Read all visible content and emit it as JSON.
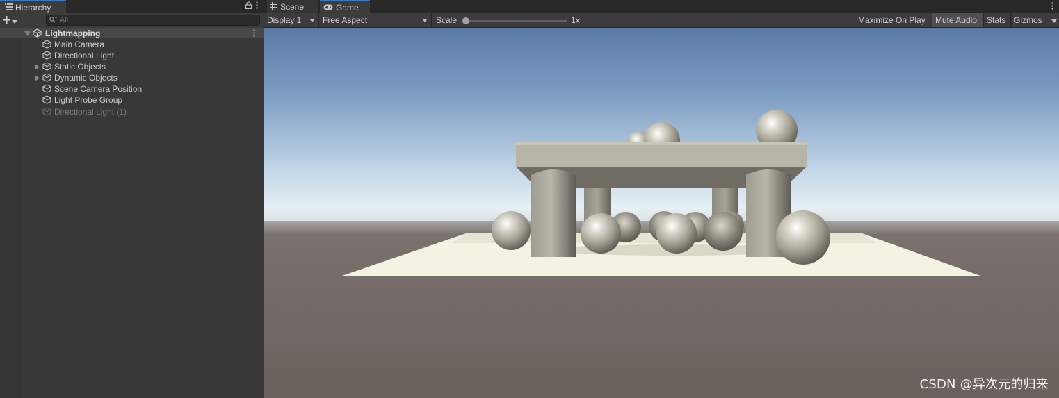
{
  "hierarchy": {
    "tab_label": "Hierarchy",
    "search_placeholder": "All",
    "scene_name": "Lightmapping",
    "items": [
      {
        "label": "Main Camera",
        "expandable": false,
        "active": true
      },
      {
        "label": "Directional Light",
        "expandable": false,
        "active": true
      },
      {
        "label": "Static Objects",
        "expandable": true,
        "active": true
      },
      {
        "label": "Dynamic Objects",
        "expandable": true,
        "active": true
      },
      {
        "label": "Scene Camera Position",
        "expandable": false,
        "active": true
      },
      {
        "label": "Light Probe Group",
        "expandable": false,
        "active": true
      },
      {
        "label": "Directional Light (1)",
        "expandable": false,
        "active": false
      }
    ]
  },
  "game_view": {
    "tabs": [
      {
        "label": "Scene",
        "icon": "grid-icon",
        "active": false
      },
      {
        "label": "Game",
        "icon": "gamepad-icon",
        "active": true
      }
    ],
    "toolbar": {
      "display_label": "Display 1",
      "aspect_label": "Free Aspect",
      "scale_label": "Scale",
      "scale_value": "1x",
      "maximize_label": "Maximize On Play",
      "mute_label": "Mute Audio",
      "mute_active": true,
      "stats_label": "Stats",
      "gizmos_label": "Gizmos"
    }
  },
  "watermark": "CSDN @异次元的归来",
  "colors": {
    "accent_tab": "#3a79bb",
    "panel_bg": "#383838",
    "toolbar_bg": "#3c3c3c",
    "sky_top": "#5a79a5",
    "sky_horizon": "#e6f0f5",
    "ground": "#6a605c",
    "floor": "#f4f2e2"
  }
}
